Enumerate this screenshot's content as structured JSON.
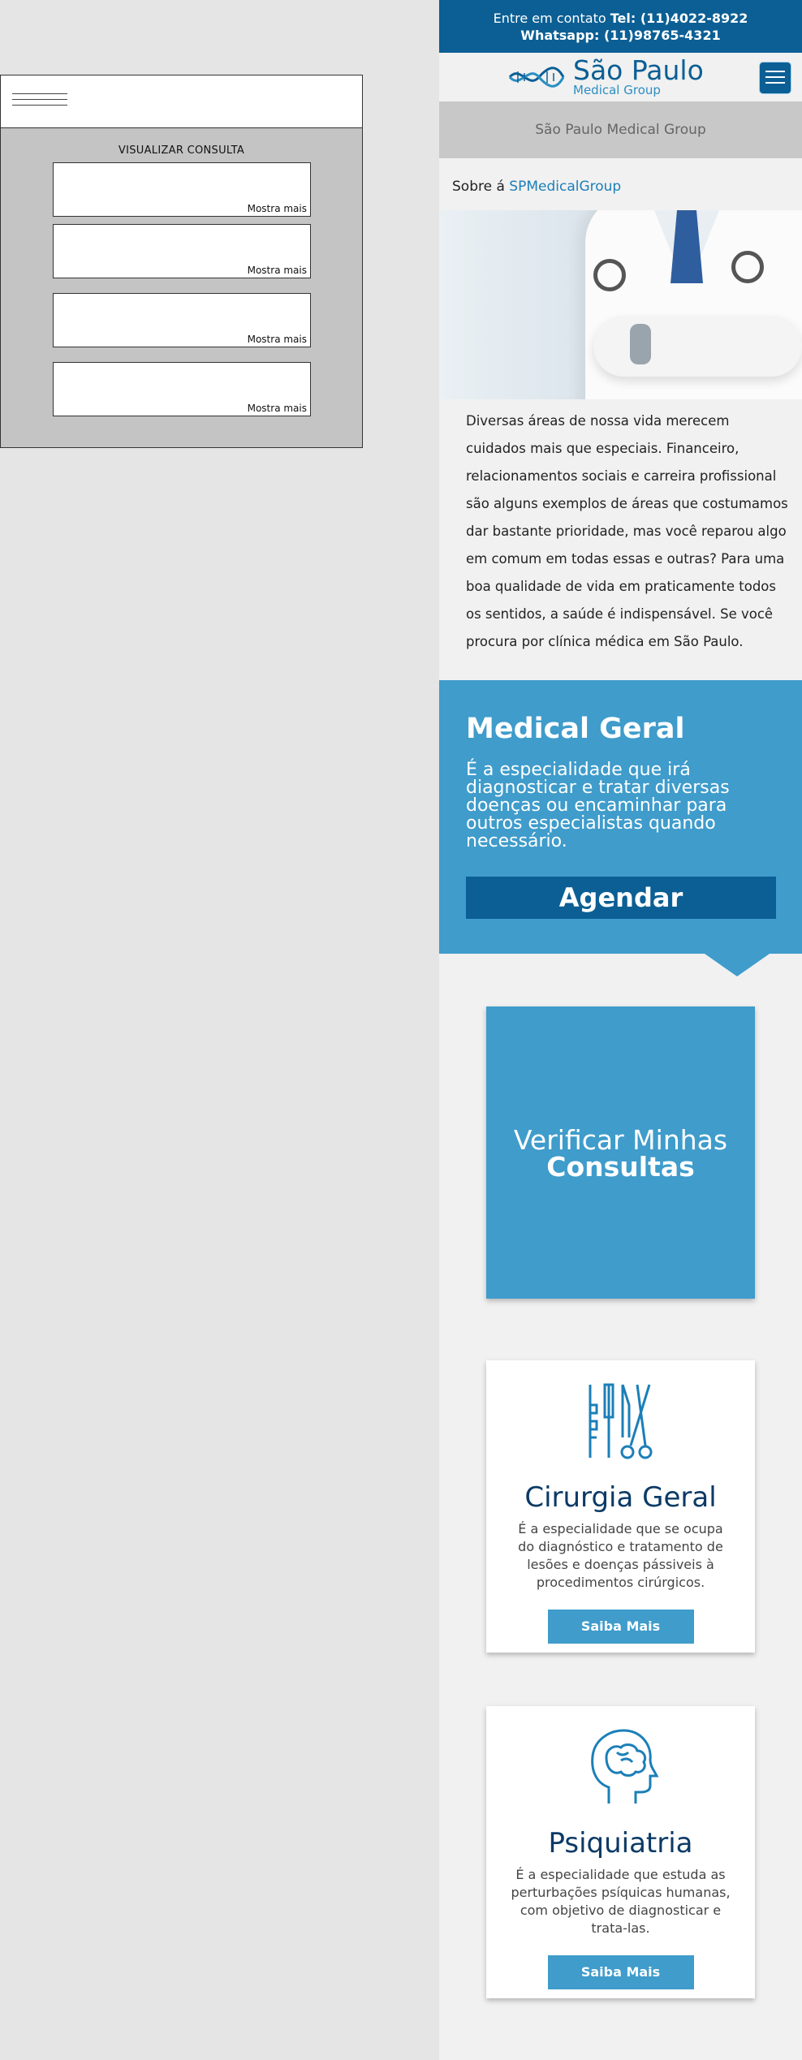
{
  "wireframe": {
    "title": "VISUALIZAR CONSULTA",
    "cards": [
      "Mostra mais",
      "Mostra mais",
      "Mostra mais",
      "Mostra mais"
    ]
  },
  "topbar": {
    "line1_prefix": "Entre em contato ",
    "line1_phone": "Tel: (11)4022-8922",
    "line2": "Whatsapp: (11)98765-4321"
  },
  "brand": {
    "main": "São Paulo",
    "sub": "Medical Group"
  },
  "greybar": "São Paulo Medical Group",
  "about": {
    "prefix": "Sobre á ",
    "link": "SPMedicalGroup"
  },
  "intro": "Diversas áreas de nossa vida merecem cuidados mais que especiais. Financeiro, relacionamentos sociais e carreira profissional são alguns exemplos de áreas que costumamos dar bastante prioridade, mas você reparou algo em comum em todas essas e outras? Para uma boa qualidade de vida em praticamente todos os sentidos, a saúde é indispensável. Se você procura por clínica médica em São Paulo.",
  "medical": {
    "title": "Medical Geral",
    "desc": "É a especialidade que irá diagnosticar e tratar diversas doenças ou encaminhar para outros especialistas quando necessário.",
    "button": "Agendar"
  },
  "verify": {
    "line1": "Verificar Minhas",
    "line2": "Consultas"
  },
  "services": [
    {
      "title": "Cirurgia Geral",
      "desc": "É a especialidade que se ocupa do diagnóstico e tratamento de lesões e doenças pássiveis à procedimentos cirúrgicos.",
      "button": "Saiba Mais",
      "icon": "surgical-tools-icon"
    },
    {
      "title": "Psiquiatria",
      "desc": "É a especialidade que estuda as perturbações psíquicas humanas, com objetivo de diagnosticar e trata-las.",
      "button": "Saiba Mais",
      "icon": "brain-head-icon"
    }
  ],
  "colors": {
    "primary": "#0b5f94",
    "accent": "#3f9ccb",
    "grey": "#c8c8c8"
  }
}
